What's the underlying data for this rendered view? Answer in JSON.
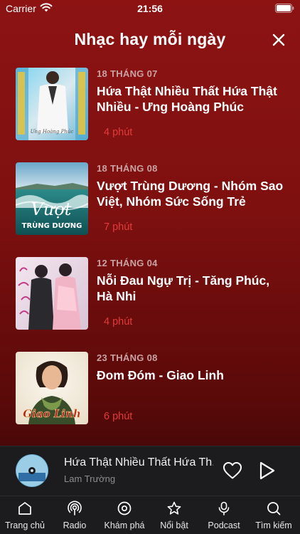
{
  "status_bar": {
    "carrier": "Carrier",
    "time": "21:56"
  },
  "header": {
    "title": "Nhạc hay mỗi ngày"
  },
  "songs": [
    {
      "date": "18 THÁNG 07",
      "title": "Hứa Thật Nhiều Thất Hứa Thật Nhiều - Ưng Hoàng Phúc",
      "duration": "4 phút",
      "art_text": "Ưng Hoàng Phúc"
    },
    {
      "date": "18 THÁNG 08",
      "title": "Vượt Trùng Dương - Nhóm Sao Việt, Nhóm Sức Sống Trẻ",
      "duration": "7 phút",
      "art_text_main": "Vượt",
      "art_text_sub": "TRÙNG DƯƠNG"
    },
    {
      "date": "12 THÁNG 04",
      "title": "Nỗi Đau Ngự Trị - Tăng Phúc, Hà Nhi",
      "duration": "4 phút"
    },
    {
      "date": "23 THÁNG 08",
      "title": "Đom Đóm - Giao Linh",
      "duration": "6 phút",
      "art_text": "Giao Linh"
    }
  ],
  "mini_player": {
    "title": "Hứa Thật Nhiều Thất Hứa Th...",
    "artist": "Lam Trường"
  },
  "tabs": [
    {
      "label": "Trang chủ",
      "icon": "home-icon"
    },
    {
      "label": "Radio",
      "icon": "radio-icon"
    },
    {
      "label": "Khám phá",
      "icon": "compass-icon"
    },
    {
      "label": "Nổi bật",
      "icon": "star-icon"
    },
    {
      "label": "Podcast",
      "icon": "podcast-icon"
    },
    {
      "label": "Tìm kiếm",
      "icon": "search-icon"
    }
  ],
  "colors": {
    "background_top": "#8d1313",
    "accent_duration": "#e23b3b",
    "tab_bar": "#1c1c1e"
  }
}
